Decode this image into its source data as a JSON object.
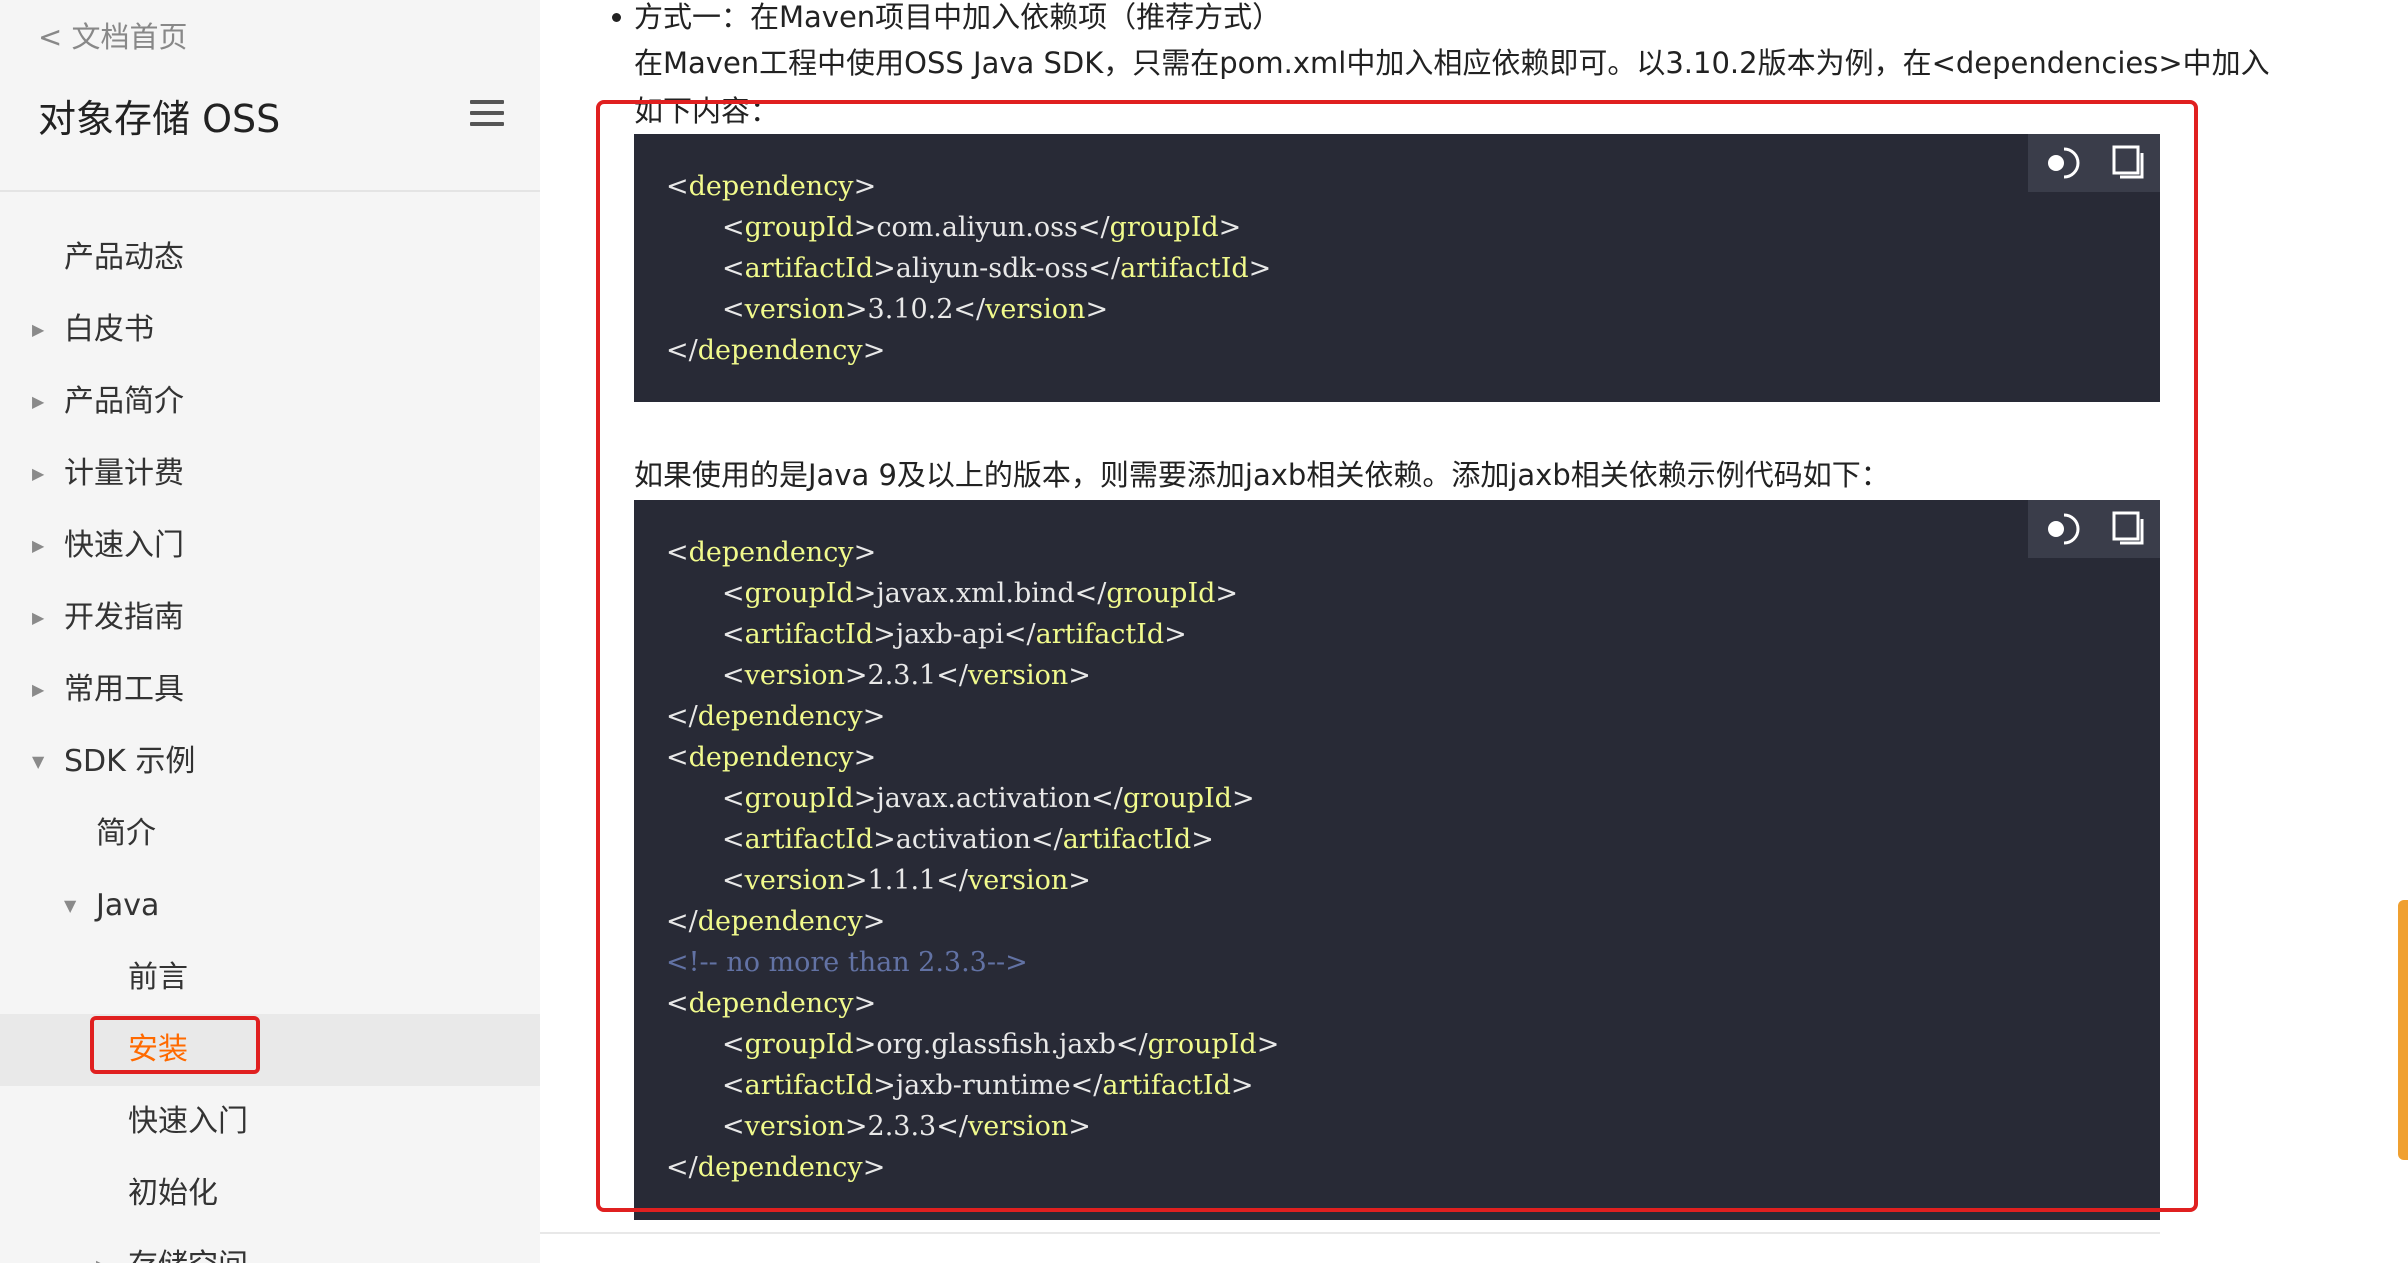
{
  "sidebar": {
    "back_link": "< 文档首页",
    "title": "对象存储 OSS",
    "items": [
      {
        "label": "产品动态",
        "caret": ""
      },
      {
        "label": "白皮书",
        "caret": "▶"
      },
      {
        "label": "产品简介",
        "caret": "▶"
      },
      {
        "label": "计量计费",
        "caret": "▶"
      },
      {
        "label": "快速入门",
        "caret": "▶"
      },
      {
        "label": "开发指南",
        "caret": "▶"
      },
      {
        "label": "常用工具",
        "caret": "▶"
      },
      {
        "label": "SDK 示例",
        "caret": "▼"
      },
      {
        "label": "简介",
        "caret": ""
      },
      {
        "label": "Java",
        "caret": "▼"
      },
      {
        "label": "前言",
        "caret": ""
      },
      {
        "label": "安装",
        "caret": "",
        "active": true
      },
      {
        "label": "快速入门",
        "caret": ""
      },
      {
        "label": "初始化",
        "caret": ""
      },
      {
        "label": "存储空间",
        "caret": "▶"
      }
    ]
  },
  "content": {
    "method_heading": "方式一：在Maven项目中加入依赖项（推荐方式）",
    "intro_line1": "在Maven工程中使用OSS Java SDK，只需在pom.xml中加入相应依赖即可。以3.10.2版本为例，在<dependencies>中加入",
    "intro_line2": "如下内容：",
    "java9_note": "如果使用的是Java 9及以上的版本，则需要添加jaxb相关依赖。添加jaxb相关依赖示例代码如下：",
    "code1": [
      {
        "indent": 0,
        "tag": "dependency",
        "close": false
      },
      {
        "indent": 1,
        "tag": "groupId",
        "value": "com.aliyun.oss"
      },
      {
        "indent": 1,
        "tag": "artifactId",
        "value": "aliyun-sdk-oss"
      },
      {
        "indent": 1,
        "tag": "version",
        "value": "3.10.2"
      },
      {
        "indent": 0,
        "tag": "dependency",
        "close": true
      }
    ],
    "code2": [
      {
        "indent": 0,
        "tag": "dependency",
        "close": false
      },
      {
        "indent": 1,
        "tag": "groupId",
        "value": "javax.xml.bind"
      },
      {
        "indent": 1,
        "tag": "artifactId",
        "value": "jaxb-api"
      },
      {
        "indent": 1,
        "tag": "version",
        "value": "2.3.1"
      },
      {
        "indent": 0,
        "tag": "dependency",
        "close": true
      },
      {
        "indent": 0,
        "tag": "dependency",
        "close": false
      },
      {
        "indent": 1,
        "tag": "groupId",
        "value": "javax.activation"
      },
      {
        "indent": 1,
        "tag": "artifactId",
        "value": "activation"
      },
      {
        "indent": 1,
        "tag": "version",
        "value": "1.1.1"
      },
      {
        "indent": 0,
        "tag": "dependency",
        "close": true
      },
      {
        "indent": 0,
        "comment": "<!-- no more than 2.3.3-->"
      },
      {
        "indent": 0,
        "tag": "dependency",
        "close": false
      },
      {
        "indent": 1,
        "tag": "groupId",
        "value": "org.glassfish.jaxb"
      },
      {
        "indent": 1,
        "tag": "artifactId",
        "value": "jaxb-runtime"
      },
      {
        "indent": 1,
        "tag": "version",
        "value": "2.3.3"
      },
      {
        "indent": 0,
        "tag": "dependency",
        "close": true
      }
    ],
    "code_tools": [
      "theme-toggle-icon",
      "copy-icon"
    ]
  },
  "colors": {
    "accent": "#ff6a00",
    "highlight_frame": "#e02020",
    "code_bg": "#282a36",
    "code_tag": "#f1fa8c",
    "code_comment": "#6272a4"
  }
}
